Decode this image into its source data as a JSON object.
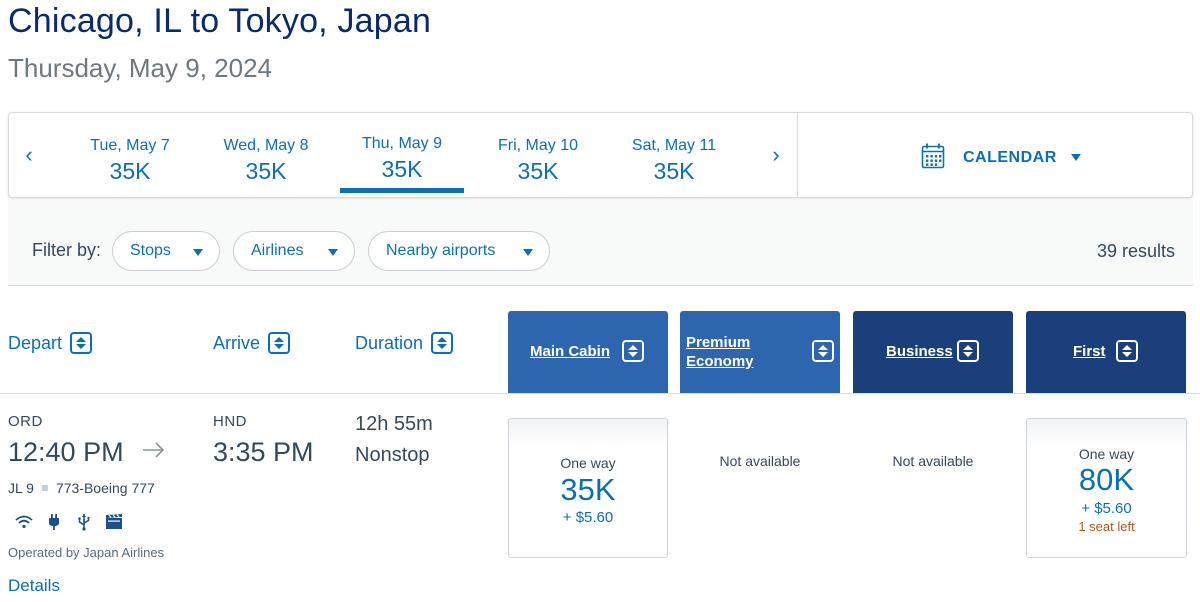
{
  "header": {
    "route": "Chicago, IL to Tokyo, Japan",
    "date": "Thursday, May 9, 2024"
  },
  "date_strip": {
    "days": [
      {
        "label": "Tue, May 7",
        "price": "35K"
      },
      {
        "label": "Wed, May 8",
        "price": "35K"
      },
      {
        "label": "Thu, May 9",
        "price": "35K",
        "selected": true
      },
      {
        "label": "Fri, May 10",
        "price": "35K"
      },
      {
        "label": "Sat, May 11",
        "price": "35K"
      }
    ],
    "calendar_label": "CALENDAR"
  },
  "filters": {
    "label": "Filter by:",
    "options": [
      "Stops",
      "Airlines",
      "Nearby airports"
    ],
    "results": "39 results"
  },
  "columns": {
    "depart": "Depart",
    "arrive": "Arrive",
    "duration": "Duration",
    "cabins": [
      {
        "line1": "Main Cabin",
        "line2": ""
      },
      {
        "line1": "Premium",
        "line2": "Economy"
      },
      {
        "line1": "Business",
        "line2": ""
      },
      {
        "line1": "First",
        "line2": ""
      }
    ]
  },
  "flight": {
    "origin_code": "ORD",
    "depart_time": "12:40 PM",
    "dest_code": "HND",
    "arrive_time": "3:35 PM",
    "flight_number": "JL 9",
    "aircraft": "773-Boeing 777",
    "amenities": [
      "wifi-icon",
      "power-plug-icon",
      "usb-icon",
      "entertainment-icon"
    ],
    "operated_by": "Operated by Japan Airlines",
    "details_label": "Details",
    "duration": "12h 55m",
    "stops": "Nonstop",
    "fares": {
      "main": {
        "label": "One way",
        "miles": "35K",
        "tax": "+ $5.60"
      },
      "premium": {
        "text": "Not available"
      },
      "business": {
        "text": "Not available"
      },
      "first": {
        "label": "One way",
        "miles": "80K",
        "tax": "+ $5.60",
        "seats": "1 seat left"
      }
    }
  },
  "colors": {
    "link_blue": "#0b6fb8",
    "title_navy": "#0b2a6b",
    "main_cabin_header": "#2e65af",
    "premium_header": "#2e65af",
    "business_header": "#1b3f7a",
    "first_header": "#1b3f7a",
    "seats_warning": "#b5561c"
  }
}
